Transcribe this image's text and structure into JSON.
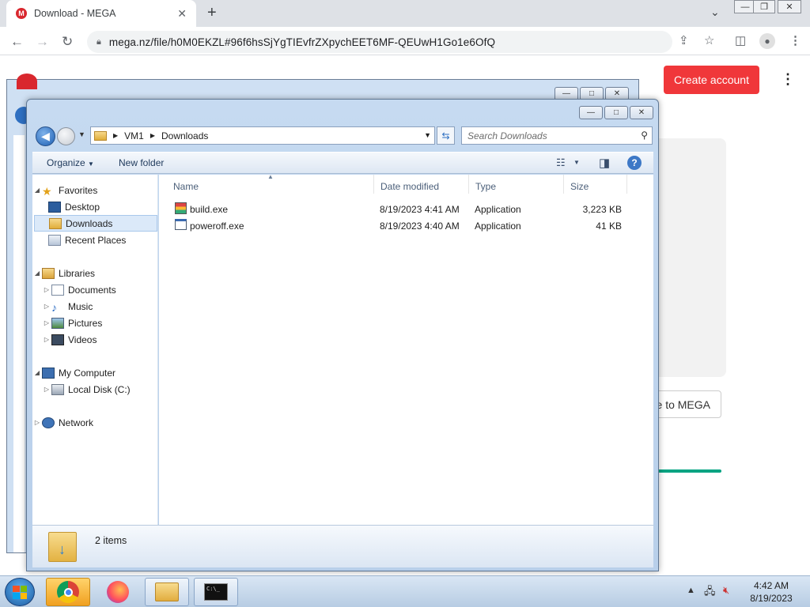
{
  "browser": {
    "tab_title": "Download - MEGA",
    "tab_favicon": "M",
    "url": "mega.nz/file/h0M0EKZL#96f6hsSjYgTIEvfrZXpychEET6MF-QEUwH1Go1e6OfQ"
  },
  "mega": {
    "create_account": "Create account",
    "save_button_partial": "e to MEGA",
    "brand_color": "#f0373a",
    "progress_color": "#00a382"
  },
  "explorer": {
    "address": {
      "root": "VM1",
      "current": "Downloads"
    },
    "search_placeholder": "Search Downloads",
    "toolbar": {
      "organize": "Organize",
      "new_folder": "New folder"
    },
    "nav": {
      "favorites": "Favorites",
      "desktop": "Desktop",
      "downloads": "Downloads",
      "recent_places": "Recent Places",
      "libraries": "Libraries",
      "documents": "Documents",
      "music": "Music",
      "pictures": "Pictures",
      "videos": "Videos",
      "my_computer": "My Computer",
      "local_disk": "Local Disk (C:)",
      "network": "Network"
    },
    "columns": {
      "name": "Name",
      "date": "Date modified",
      "type": "Type",
      "size": "Size"
    },
    "files": [
      {
        "name": "build.exe",
        "date": "8/19/2023 4:41 AM",
        "type": "Application",
        "size": "3,223 KB"
      },
      {
        "name": "poweroff.exe",
        "date": "8/19/2023 4:40 AM",
        "type": "Application",
        "size": "41 KB"
      }
    ],
    "status": "2 items"
  },
  "taskbar": {
    "time": "4:42 AM",
    "date": "8/19/2023",
    "cmd_label": "C:\\_"
  }
}
